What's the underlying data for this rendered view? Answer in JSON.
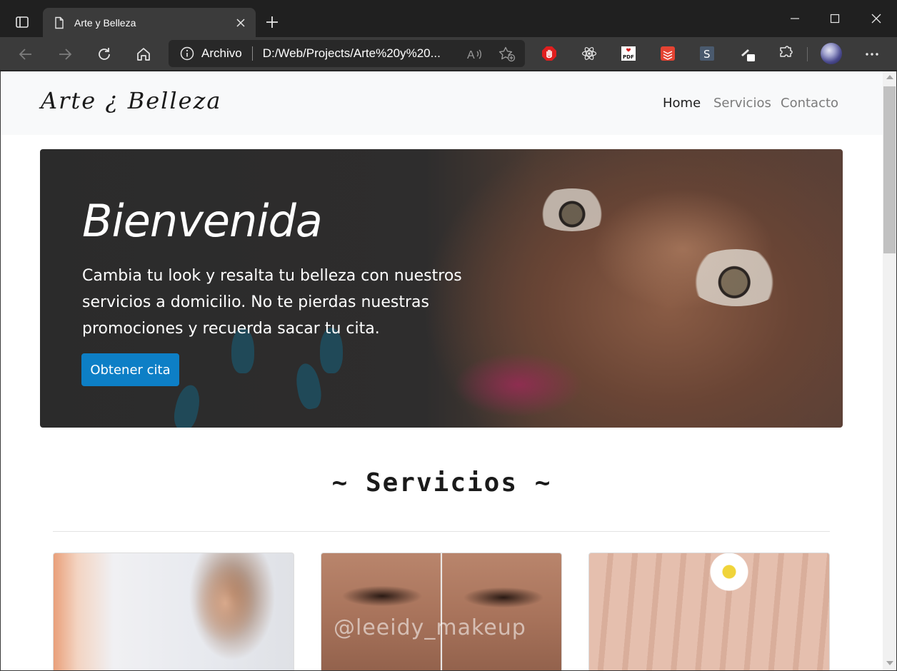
{
  "browser": {
    "tab_title": "Arte y Belleza",
    "address": {
      "scheme": "Archivo",
      "url": "D:/Web/Projects/Arte%20y%20..."
    },
    "extensions": [
      "stop-hand-icon",
      "react-icon",
      "pdf-icon",
      "todoist-icon",
      "s-icon",
      "pen-icon"
    ],
    "ext_s_label": "S",
    "ext_pdf_label": "PDF"
  },
  "site": {
    "brand": "Arte ¿ Belleza",
    "nav": {
      "home": "Home",
      "services": "Servicios",
      "contact": "Contacto"
    }
  },
  "hero": {
    "title": "Bienvenida",
    "text": "Cambia tu look y resalta tu belleza con nuestros servicios a domicilio. No te pierdas nuestras promociones y recuerda sacar tu cita.",
    "cta": "Obtener cita"
  },
  "services": {
    "title": "~ Servicios ~",
    "watermark": "@leeidy_makeup"
  },
  "colors": {
    "accent": "#0d7fc6",
    "chrome_dark": "#202020",
    "chrome_toolbar": "#3b3b3b",
    "nav_bg": "#f8f9fa"
  }
}
